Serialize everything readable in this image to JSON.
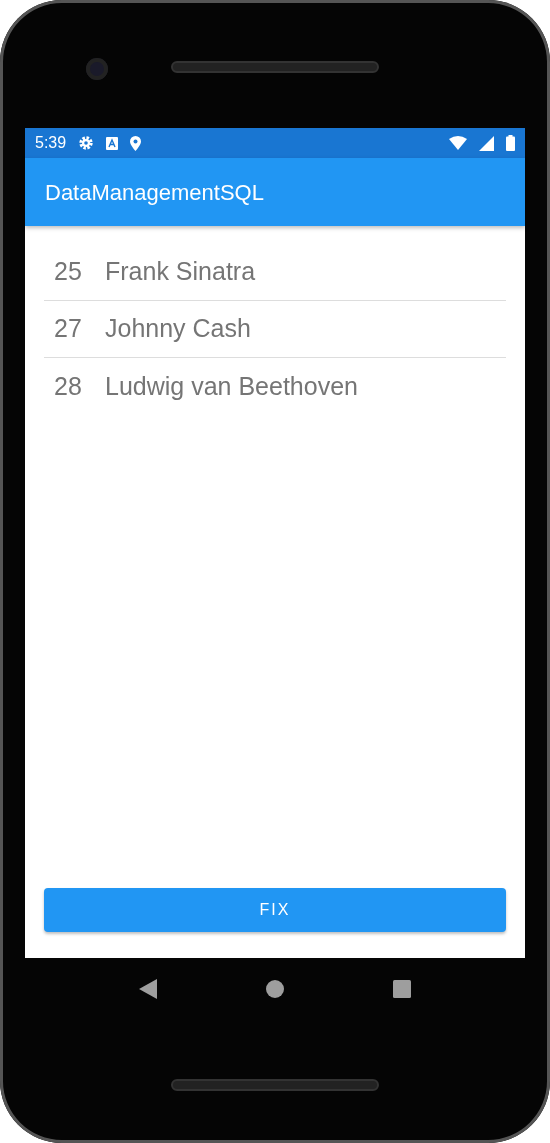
{
  "status_bar": {
    "time": "5:39"
  },
  "app_bar": {
    "title": "DataManagementSQL"
  },
  "rows": [
    {
      "number": "25",
      "name": "Frank Sinatra"
    },
    {
      "number": "27",
      "name": "Johnny Cash"
    },
    {
      "number": "28",
      "name": "Ludwig van Beethoven"
    }
  ],
  "button": {
    "label": "FIX"
  }
}
